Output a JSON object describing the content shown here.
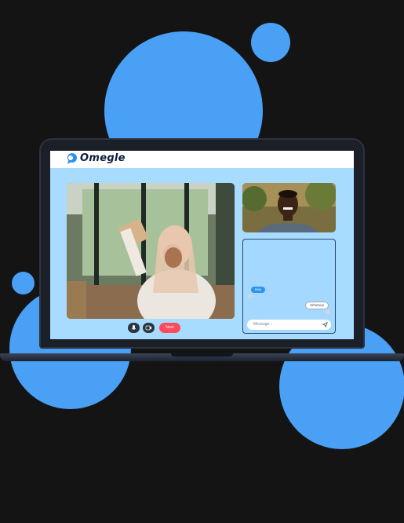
{
  "colors": {
    "background": "#141414",
    "accent_blue": "#4aa0f5",
    "screen_bg": "#a8dcff",
    "next_button": "#ff4a5a",
    "sent_bubble": "#2c93ee"
  },
  "app": {
    "logo_text": "Omegle",
    "logo_icon": "chat-bubble-icon"
  },
  "chat": {
    "messages": [
      {
        "text": "Hey",
        "side": "left"
      },
      {
        "text": "Whatsup",
        "side": "right"
      }
    ],
    "input_placeholder": "Message...",
    "send_icon": "send-icon"
  },
  "controls": {
    "mic_icon": "mic-icon",
    "camera_icon": "camera-icon",
    "next_label": "Next"
  }
}
